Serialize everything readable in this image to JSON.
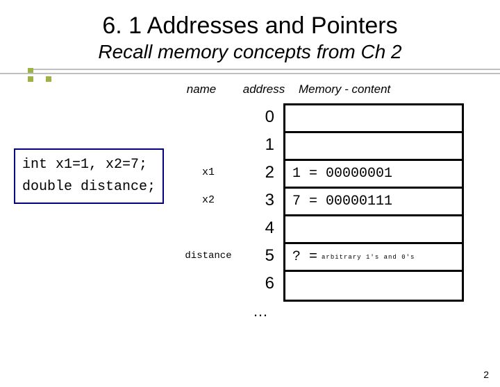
{
  "title": "6. 1 Addresses and Pointers",
  "subtitle": "Recall memory concepts from Ch 2",
  "headers": {
    "name": "name",
    "address": "address",
    "memory": "Memory - content"
  },
  "code": {
    "line1": "int x1=1, x2=7;",
    "line2": "double distance;"
  },
  "names": {
    "r2": "x1",
    "r3": "x2",
    "r5": "distance"
  },
  "addr": {
    "r0": "0",
    "r1": "1",
    "r2": "2",
    "r3": "3",
    "r4": "4",
    "r5": "5",
    "r6": "6",
    "r7": "…"
  },
  "mem": {
    "r2": "1 = 00000001",
    "r3": "7 = 00000111",
    "r5_prefix": "? =",
    "r5_arb": "arbitrary 1's and 0's"
  },
  "pagenum": "2"
}
